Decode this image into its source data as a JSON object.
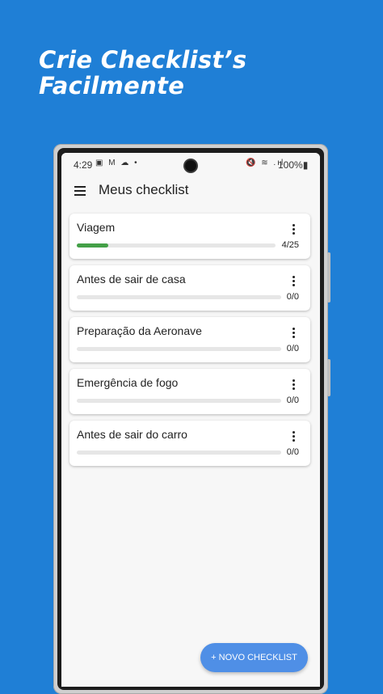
{
  "headline": {
    "line1": "Crie Checklist’s",
    "line2": "Facilmente"
  },
  "statusbar": {
    "time": "4:29",
    "left_icons": "▣ M ☁ •",
    "right_icons": "🔇 ≋ .ıl",
    "battery": "100%▮"
  },
  "appbar": {
    "title": "Meus checklist",
    "menu_icon": "hamburger-menu-icon"
  },
  "colors": {
    "background": "#1f7fd6",
    "progress": "#43a047",
    "fab": "#4f8fe6"
  },
  "checklists": [
    {
      "title": "Viagem",
      "count": "4/25",
      "progress": 0.16
    },
    {
      "title": "Antes de sair de casa",
      "count": "0/0",
      "progress": 0
    },
    {
      "title": "Preparação da Aeronave",
      "count": "0/0",
      "progress": 0
    },
    {
      "title": "Emergência de fogo",
      "count": "0/0",
      "progress": 0
    },
    {
      "title": "Antes de sair do carro",
      "count": "0/0",
      "progress": 0
    }
  ],
  "fab": {
    "label": "+ NOVO CHECKLIST"
  }
}
